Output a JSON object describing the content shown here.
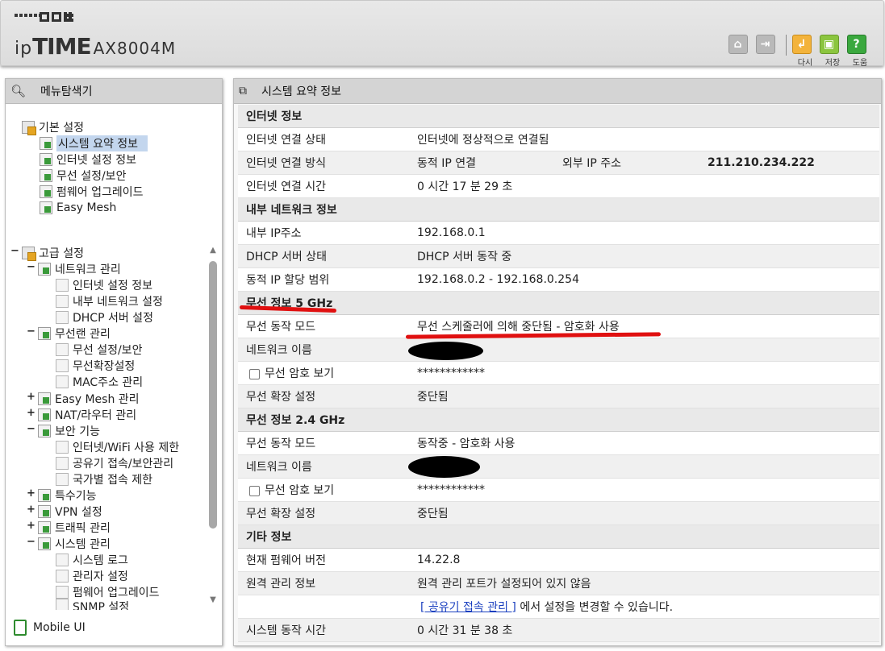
{
  "header": {
    "brand_ip": "ip",
    "brand_time": "TIME",
    "model": "AX8004M",
    "icons": [
      {
        "name": "home-icon",
        "label": ""
      },
      {
        "name": "logout-icon",
        "label": ""
      },
      {
        "name": "reload-icon",
        "label": "다시"
      },
      {
        "name": "save-icon",
        "label": "저장"
      },
      {
        "name": "help-icon",
        "label": "도움"
      }
    ]
  },
  "sidebar": {
    "title": "메뉴탐색기",
    "basic": {
      "label": "기본 설정",
      "items": [
        "시스템 요약 정보",
        "인터넷 설정 정보",
        "무선 설정/보안",
        "펌웨어 업그레이드",
        "Easy Mesh"
      ]
    },
    "advanced": {
      "label": "고급 설정",
      "network": {
        "label": "네트워크 관리",
        "items": [
          "인터넷 설정 정보",
          "내부 네트워크 설정",
          "DHCP 서버 설정"
        ]
      },
      "wireless": {
        "label": "무선랜 관리",
        "items": [
          "무선 설정/보안",
          "무선확장설정",
          "MAC주소 관리"
        ]
      },
      "easymesh": "Easy Mesh 관리",
      "nat": "NAT/라우터 관리",
      "security": {
        "label": "보안 기능",
        "items": [
          "인터넷/WiFi 사용 제한",
          "공유기 접속/보안관리",
          "국가별 접속 제한"
        ]
      },
      "special": "특수기능",
      "vpn": "VPN 설정",
      "traffic": "트래픽 관리",
      "system": {
        "label": "시스템 관리",
        "items": [
          "시스템 로그",
          "관리자 설정",
          "펌웨어 업그레이드",
          "SNMP 설정"
        ]
      }
    },
    "mobile": "Mobile UI"
  },
  "main": {
    "title": "시스템 요약 정보",
    "internet": {
      "section": "인터넷 정보",
      "status_label": "인터넷 연결 상태",
      "status_value": "인터넷에 정상적으로 연결됨",
      "method_label": "인터넷 연결 방식",
      "method_value": "동적 IP 연결",
      "ext_ip_label": "외부 IP 주소",
      "ext_ip_value": "211.210.234.222",
      "time_label": "인터넷 연결 시간",
      "time_value": "0 시간 17 분 29 초"
    },
    "lan": {
      "section": "내부 네트워크 정보",
      "ip_label": "내부 IP주소",
      "ip_value": "192.168.0.1",
      "dhcp_label": "DHCP 서버 상태",
      "dhcp_value": "DHCP 서버 동작 중",
      "range_label": "동적 IP 할당 범위",
      "range_value": "192.168.0.2 -  192.168.0.254"
    },
    "wifi5": {
      "section": "무선 정보 5 GHz",
      "mode_label": "무선 동작 모드",
      "mode_value": "무선 스케줄러에 의해 중단됨 - 암호화 사용",
      "name_label": "네트워크 이름",
      "pw_label": "무선 암호 보기",
      "pw_value": "************",
      "ext_label": "무선 확장 설정",
      "ext_value": "중단됨"
    },
    "wifi24": {
      "section": "무선 정보 2.4 GHz",
      "mode_label": "무선 동작 모드",
      "mode_value": "동작중 - 암호화 사용",
      "name_label": "네트워크 이름",
      "pw_label": "무선 암호 보기",
      "pw_value": "************",
      "ext_label": "무선 확장 설정",
      "ext_value": "중단됨"
    },
    "etc": {
      "section": "기타 정보",
      "fw_label": "현재 펌웨어 버전",
      "fw_value": "14.22.8",
      "remote_label": "원격 관리 정보",
      "remote_value": "원격 관리 포트가 설정되어 있지 않음",
      "remote_link": "[ 공유기 접속 관리 ]",
      "remote_suffix": " 에서 설정을 변경할 수 있습니다.",
      "uptime_label": "시스템 동작 시간",
      "uptime_value": "0 시간 31 분 38 초"
    }
  },
  "colors": {
    "highlight": "#c3d6ee",
    "annotation_red": "#e01010"
  }
}
